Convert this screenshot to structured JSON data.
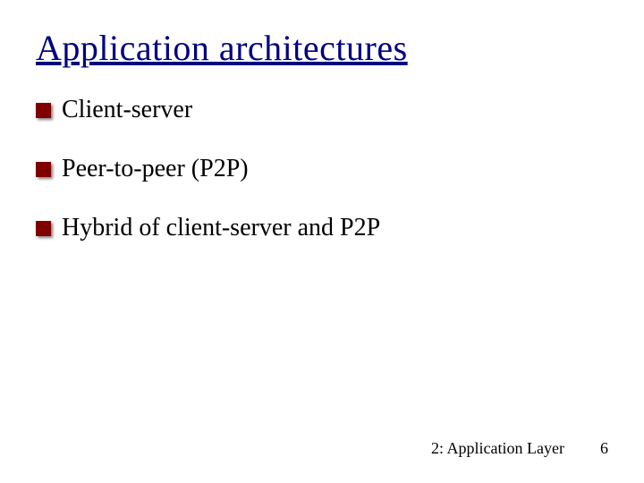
{
  "slide": {
    "title": "Application architectures",
    "bullets": [
      {
        "text": "Client-server"
      },
      {
        "text": "Peer-to-peer (P2P)"
      },
      {
        "text": "Hybrid of client-server and P2P"
      }
    ],
    "footer": {
      "section": "2: Application Layer",
      "page": "6"
    }
  }
}
